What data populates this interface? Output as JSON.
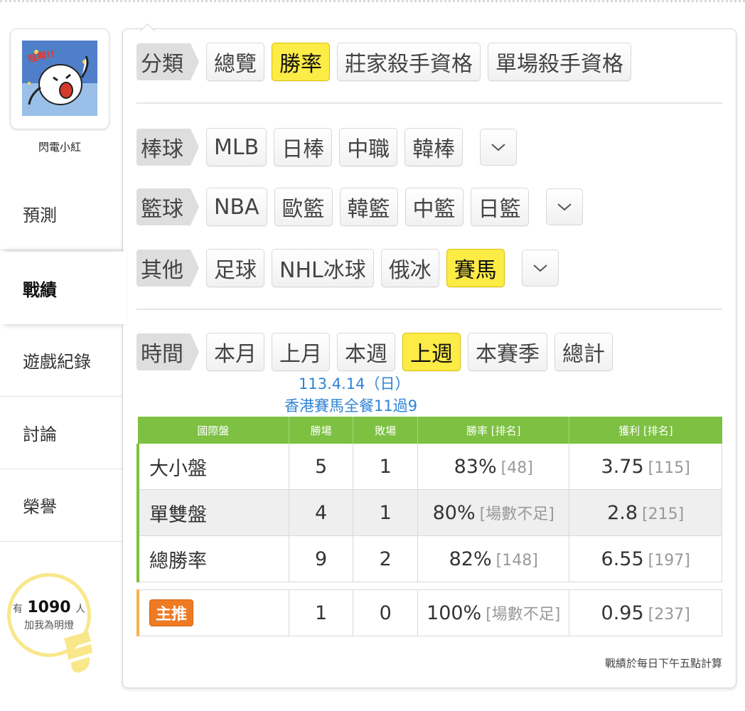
{
  "sidebar": {
    "avatar_text": "哇啊!!",
    "username": "閃電小紅",
    "nav": [
      {
        "label": "預測"
      },
      {
        "label": "戰績"
      },
      {
        "label": "遊戲紀錄"
      },
      {
        "label": "討論"
      },
      {
        "label": "榮譽"
      }
    ],
    "active_nav": "戰績",
    "fans": {
      "prefix": "有",
      "count": "1090",
      "suffix": "人",
      "line2": "加我為明燈"
    }
  },
  "filters": {
    "classify": {
      "label": "分類",
      "options": [
        "總覽",
        "勝率",
        "莊家殺手資格",
        "單場殺手資格"
      ],
      "selected": "勝率"
    },
    "baseball": {
      "label": "棒球",
      "options": [
        "MLB",
        "日棒",
        "中職",
        "韓棒"
      ],
      "dropdown_icon": "chevron-down-icon"
    },
    "basketball": {
      "label": "籃球",
      "options": [
        "NBA",
        "歐籃",
        "韓籃",
        "中籃",
        "日籃"
      ],
      "dropdown_icon": "chevron-down-icon"
    },
    "other": {
      "label": "其他",
      "options": [
        "足球",
        "NHL冰球",
        "俄冰",
        "賽馬"
      ],
      "selected": "賽馬",
      "dropdown_icon": "chevron-down-icon"
    },
    "time": {
      "label": "時間",
      "options": [
        "本月",
        "上月",
        "本週",
        "上週",
        "本賽季",
        "總計"
      ],
      "selected": "上週"
    }
  },
  "record": {
    "date": "113.4.14（日）",
    "event": "香港賽馬全餐11過9",
    "headers": [
      "國際盤",
      "勝場",
      "敗場",
      "勝率 [排名]",
      "獲利 [排名]"
    ],
    "rows": [
      {
        "name": "大小盤",
        "win": "5",
        "lose": "1",
        "rate": "83%",
        "rate_rank": "[48]",
        "profit": "3.75",
        "profit_rank": "[115]"
      },
      {
        "name": "單雙盤",
        "win": "4",
        "lose": "1",
        "rate": "80%",
        "rate_rank": "[場數不足]",
        "profit": "2.8",
        "profit_rank": "[215]"
      },
      {
        "name": "總勝率",
        "win": "9",
        "lose": "2",
        "rate": "82%",
        "rate_rank": "[148]",
        "profit": "6.55",
        "profit_rank": "[197]"
      }
    ],
    "main_pick": {
      "badge": "主推",
      "win": "1",
      "lose": "0",
      "rate": "100%",
      "rate_rank": "[場數不足]",
      "profit": "0.95",
      "profit_rank": "[237]"
    },
    "note": "戰績於每日下午五點計算"
  },
  "colors": {
    "accent_yellow": "#fdeb46",
    "table_green": "#7dc042",
    "link_blue": "#2f83d6",
    "badge_orange": "#ee7a24"
  }
}
